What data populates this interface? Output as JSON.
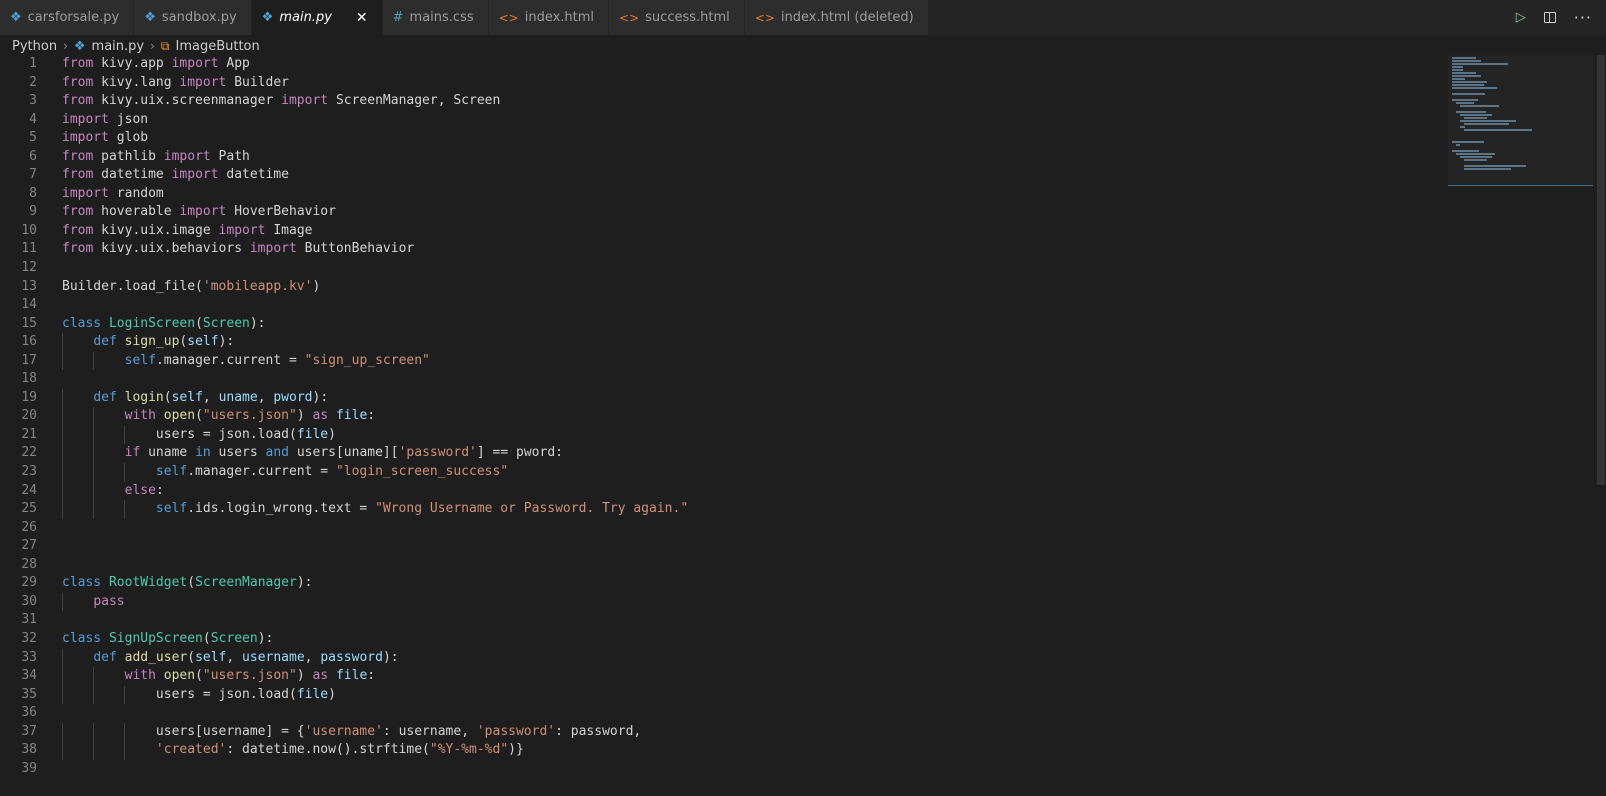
{
  "tabs": [
    {
      "label": "carsforsale.py",
      "icon": "python-icon",
      "active": false
    },
    {
      "label": "sandbox.py",
      "icon": "python-icon",
      "active": false
    },
    {
      "label": "main.py",
      "icon": "python-icon",
      "active": true
    },
    {
      "label": "mains.css",
      "icon": "css-icon",
      "active": false
    },
    {
      "label": "index.html",
      "icon": "html-icon",
      "active": false
    },
    {
      "label": "success.html",
      "icon": "html-icon",
      "active": false
    },
    {
      "label": "index.html (deleted)",
      "icon": "html-icon",
      "active": false
    }
  ],
  "breadcrumb": {
    "folder": "Python",
    "file": "main.py",
    "symbol": "ImageButton"
  },
  "colors": {
    "keyword": "#c586c0",
    "keyword_blue": "#569cd6",
    "function": "#dcdcaa",
    "class": "#4ec9b0",
    "string": "#ce9178",
    "variable": "#9cdcfe"
  },
  "code_lines": [
    [
      [
        "kw",
        "from"
      ],
      [
        "t",
        " kivy.app "
      ],
      [
        "kw",
        "import"
      ],
      [
        "t",
        " App"
      ]
    ],
    [
      [
        "kw",
        "from"
      ],
      [
        "t",
        " kivy.lang "
      ],
      [
        "kw",
        "import"
      ],
      [
        "t",
        " Builder"
      ]
    ],
    [
      [
        "kw",
        "from"
      ],
      [
        "t",
        " kivy.uix.screenmanager "
      ],
      [
        "kw",
        "import"
      ],
      [
        "t",
        " ScreenManager, Screen"
      ]
    ],
    [
      [
        "kw",
        "import"
      ],
      [
        "t",
        " json"
      ]
    ],
    [
      [
        "kw",
        "import"
      ],
      [
        "t",
        " glob"
      ]
    ],
    [
      [
        "kw",
        "from"
      ],
      [
        "t",
        " pathlib "
      ],
      [
        "kw",
        "import"
      ],
      [
        "t",
        " Path"
      ]
    ],
    [
      [
        "kw",
        "from"
      ],
      [
        "t",
        " datetime "
      ],
      [
        "kw",
        "import"
      ],
      [
        "t",
        " datetime"
      ]
    ],
    [
      [
        "kw",
        "import"
      ],
      [
        "t",
        " random"
      ]
    ],
    [
      [
        "kw",
        "from"
      ],
      [
        "t",
        " hoverable "
      ],
      [
        "kw",
        "import"
      ],
      [
        "t",
        " HoverBehavior"
      ]
    ],
    [
      [
        "kw",
        "from"
      ],
      [
        "t",
        " kivy.uix.image "
      ],
      [
        "kw",
        "import"
      ],
      [
        "t",
        " Image"
      ]
    ],
    [
      [
        "kw",
        "from"
      ],
      [
        "t",
        " kivy.uix.behaviors "
      ],
      [
        "kw",
        "import"
      ],
      [
        "t",
        " ButtonBehavior"
      ]
    ],
    [],
    [
      [
        "t",
        "Builder.load_file("
      ],
      [
        "str",
        "'mobileapp.kv'"
      ],
      [
        "t",
        ")"
      ]
    ],
    [],
    [
      [
        "kwb",
        "class"
      ],
      [
        "t",
        " "
      ],
      [
        "cls",
        "LoginScreen"
      ],
      [
        "t",
        "("
      ],
      [
        "cls",
        "Screen"
      ],
      [
        "t",
        "):"
      ]
    ],
    [
      [
        "t",
        "    "
      ],
      [
        "kwb",
        "def"
      ],
      [
        "t",
        " "
      ],
      [
        "fn",
        "sign_up"
      ],
      [
        "t",
        "("
      ],
      [
        "var",
        "self"
      ],
      [
        "t",
        "):"
      ]
    ],
    [
      [
        "t",
        "        "
      ],
      [
        "self",
        "self"
      ],
      [
        "t",
        ".manager.current = "
      ],
      [
        "str",
        "\"sign_up_screen\""
      ]
    ],
    [],
    [
      [
        "t",
        "    "
      ],
      [
        "kwb",
        "def"
      ],
      [
        "t",
        " "
      ],
      [
        "fn",
        "login"
      ],
      [
        "t",
        "("
      ],
      [
        "var",
        "self"
      ],
      [
        "t",
        ", "
      ],
      [
        "var",
        "uname"
      ],
      [
        "t",
        ", "
      ],
      [
        "var",
        "pword"
      ],
      [
        "t",
        "):"
      ]
    ],
    [
      [
        "t",
        "        "
      ],
      [
        "kw",
        "with"
      ],
      [
        "t",
        " "
      ],
      [
        "fn",
        "open"
      ],
      [
        "t",
        "("
      ],
      [
        "str",
        "\"users.json\""
      ],
      [
        "t",
        ") "
      ],
      [
        "kw",
        "as"
      ],
      [
        "t",
        " "
      ],
      [
        "var",
        "file"
      ],
      [
        "t",
        ":"
      ]
    ],
    [
      [
        "t",
        "            users = json.load("
      ],
      [
        "var",
        "file"
      ],
      [
        "t",
        ")"
      ]
    ],
    [
      [
        "t",
        "        "
      ],
      [
        "kw",
        "if"
      ],
      [
        "t",
        " uname "
      ],
      [
        "kwb",
        "in"
      ],
      [
        "t",
        " users "
      ],
      [
        "kwb",
        "and"
      ],
      [
        "t",
        " users[uname]["
      ],
      [
        "str",
        "'password'"
      ],
      [
        "t",
        "] == pword:"
      ]
    ],
    [
      [
        "t",
        "            "
      ],
      [
        "self",
        "self"
      ],
      [
        "t",
        ".manager.current = "
      ],
      [
        "str",
        "\"login_screen_success\""
      ]
    ],
    [
      [
        "t",
        "        "
      ],
      [
        "kw",
        "else"
      ],
      [
        "t",
        ":"
      ]
    ],
    [
      [
        "t",
        "            "
      ],
      [
        "self",
        "self"
      ],
      [
        "t",
        ".ids.login_wrong.text = "
      ],
      [
        "str",
        "\"Wrong Username or Password. Try again.\""
      ]
    ],
    [],
    [],
    [],
    [
      [
        "kwb",
        "class"
      ],
      [
        "t",
        " "
      ],
      [
        "cls",
        "RootWidget"
      ],
      [
        "t",
        "("
      ],
      [
        "cls",
        "ScreenManager"
      ],
      [
        "t",
        "):"
      ]
    ],
    [
      [
        "t",
        "    "
      ],
      [
        "kw",
        "pass"
      ]
    ],
    [],
    [
      [
        "kwb",
        "class"
      ],
      [
        "t",
        " "
      ],
      [
        "cls",
        "SignUpScreen"
      ],
      [
        "t",
        "("
      ],
      [
        "cls",
        "Screen"
      ],
      [
        "t",
        "):"
      ]
    ],
    [
      [
        "t",
        "    "
      ],
      [
        "kwb",
        "def"
      ],
      [
        "t",
        " "
      ],
      [
        "fn",
        "add_user"
      ],
      [
        "t",
        "("
      ],
      [
        "var",
        "self"
      ],
      [
        "t",
        ", "
      ],
      [
        "var",
        "username"
      ],
      [
        "t",
        ", "
      ],
      [
        "var",
        "password"
      ],
      [
        "t",
        "):"
      ]
    ],
    [
      [
        "t",
        "        "
      ],
      [
        "kw",
        "with"
      ],
      [
        "t",
        " "
      ],
      [
        "fn",
        "open"
      ],
      [
        "t",
        "("
      ],
      [
        "str",
        "\"users.json\""
      ],
      [
        "t",
        ") "
      ],
      [
        "kw",
        "as"
      ],
      [
        "t",
        " "
      ],
      [
        "var",
        "file"
      ],
      [
        "t",
        ":"
      ]
    ],
    [
      [
        "t",
        "            users = json.load("
      ],
      [
        "var",
        "file"
      ],
      [
        "t",
        ")"
      ]
    ],
    [],
    [
      [
        "t",
        "            users[username] = {"
      ],
      [
        "str",
        "'username'"
      ],
      [
        "t",
        ": username, "
      ],
      [
        "str",
        "'password'"
      ],
      [
        "t",
        ": password,"
      ]
    ],
    [
      [
        "t",
        "            "
      ],
      [
        "str",
        "'created'"
      ],
      [
        "t",
        ": datetime.now().strftime("
      ],
      [
        "str",
        "\"%Y-%m-%d\""
      ],
      [
        "t",
        ")}"
      ]
    ],
    []
  ]
}
